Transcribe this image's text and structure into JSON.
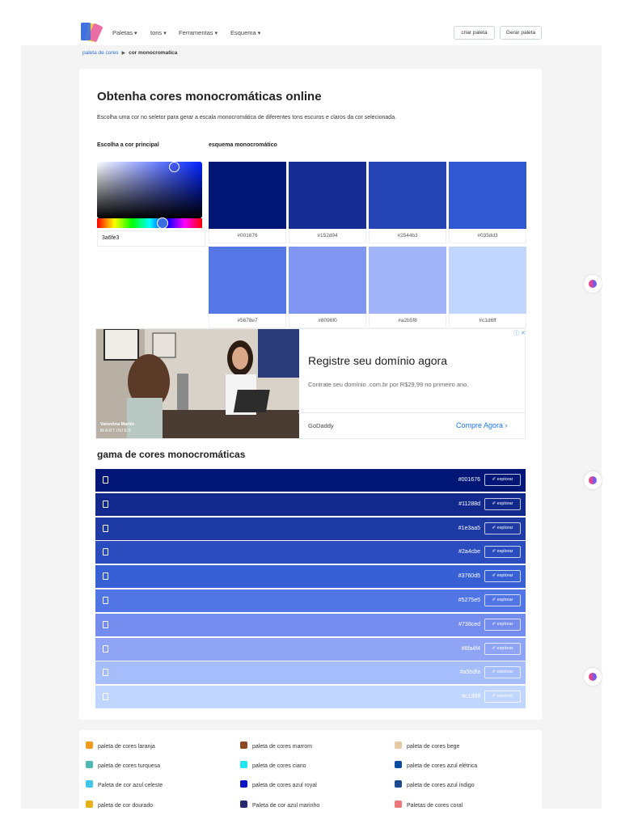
{
  "nav": {
    "items": [
      "Paletas",
      "tons",
      "Ferramentas",
      "Esquema"
    ],
    "create_btn": "criar paleta",
    "generate_btn": "Gerar paleta"
  },
  "breadcrumb": {
    "home": "paleta de cores",
    "current": "cor monocromatica"
  },
  "main": {
    "title": "Obtenha cores monocromáticas online",
    "lead": "Escolha uma cor no seletor para gerar a escala monocromática de diferentes tons escuros e claros da cor selecionada.",
    "picker_label": "Escolha a cor principal",
    "scheme_label": "esquema monocromático",
    "hex_value": "3a6fe3",
    "swatches": [
      {
        "hex": "#001676",
        "color": "#001676"
      },
      {
        "hex": "#152d94",
        "color": "#152d94"
      },
      {
        "hex": "#2544b3",
        "color": "#2544b3"
      },
      {
        "hex": "#035dd3",
        "color": "#3158d3"
      },
      {
        "hex": "#5678e7",
        "color": "#5678e7"
      },
      {
        "hex": "#8096f0",
        "color": "#8096f0"
      },
      {
        "hex": "#a2b5f8",
        "color": "#a2b5f8"
      },
      {
        "hex": "#c1d6ff",
        "color": "#c1d6ff"
      }
    ]
  },
  "ad": {
    "title": "Registre seu domínio agora",
    "desc": "Contrate seu domínio .com.br por R$29,99 no primeiro ano.",
    "brand": "GoDaddy",
    "cta": "Compre Agora",
    "photo_caption_1": "Valentina Martin",
    "photo_caption_2": "MARTINIES"
  },
  "range": {
    "title": "gama de cores monocromáticas",
    "explore_label": "explorar",
    "rows": [
      {
        "hex": "#001676",
        "color": "#001676"
      },
      {
        "hex": "#11288d",
        "color": "#11288d"
      },
      {
        "hex": "#1e3aa5",
        "color": "#1e3aa5"
      },
      {
        "hex": "#2a4cbe",
        "color": "#2a4cbe"
      },
      {
        "hex": "#3760d5",
        "color": "#3760d5"
      },
      {
        "hex": "#5275e5",
        "color": "#5275e5"
      },
      {
        "hex": "#738ced",
        "color": "#738ced"
      },
      {
        "hex": "#8fa4f4",
        "color": "#8fa4f4"
      },
      {
        "hex": "#a5bdfa",
        "color": "#a5bdfa"
      },
      {
        "hex": "#c1d6ff",
        "color": "#c1d6ff"
      }
    ]
  },
  "palettes": [
    {
      "label": "paleta de cores laranja",
      "color": "#f29a1f"
    },
    {
      "label": "paleta de cores marrom",
      "color": "#8a4a24"
    },
    {
      "label": "paleta de cores bege",
      "color": "#e5c9a7"
    },
    {
      "label": "paleta de cores turquesa",
      "color": "#4fb8b0"
    },
    {
      "label": "paleta de cores ciano",
      "color": "#22e5f0"
    },
    {
      "label": "paleta de cores azul elétrica",
      "color": "#0b4a9e"
    },
    {
      "label": "Paleta de cor azul celeste",
      "color": "#3fc4ea"
    },
    {
      "label": "paleta de cores azul royal",
      "color": "#0a14c4"
    },
    {
      "label": "paleta de cores azul índigo",
      "color": "#1c4a8e"
    },
    {
      "label": "paleta de cor dourado",
      "color": "#e6b11a"
    },
    {
      "label": "Paleta de cor azul marinho",
      "color": "#27286e"
    },
    {
      "label": "Paletas de cores coral",
      "color": "#ee7777"
    }
  ]
}
